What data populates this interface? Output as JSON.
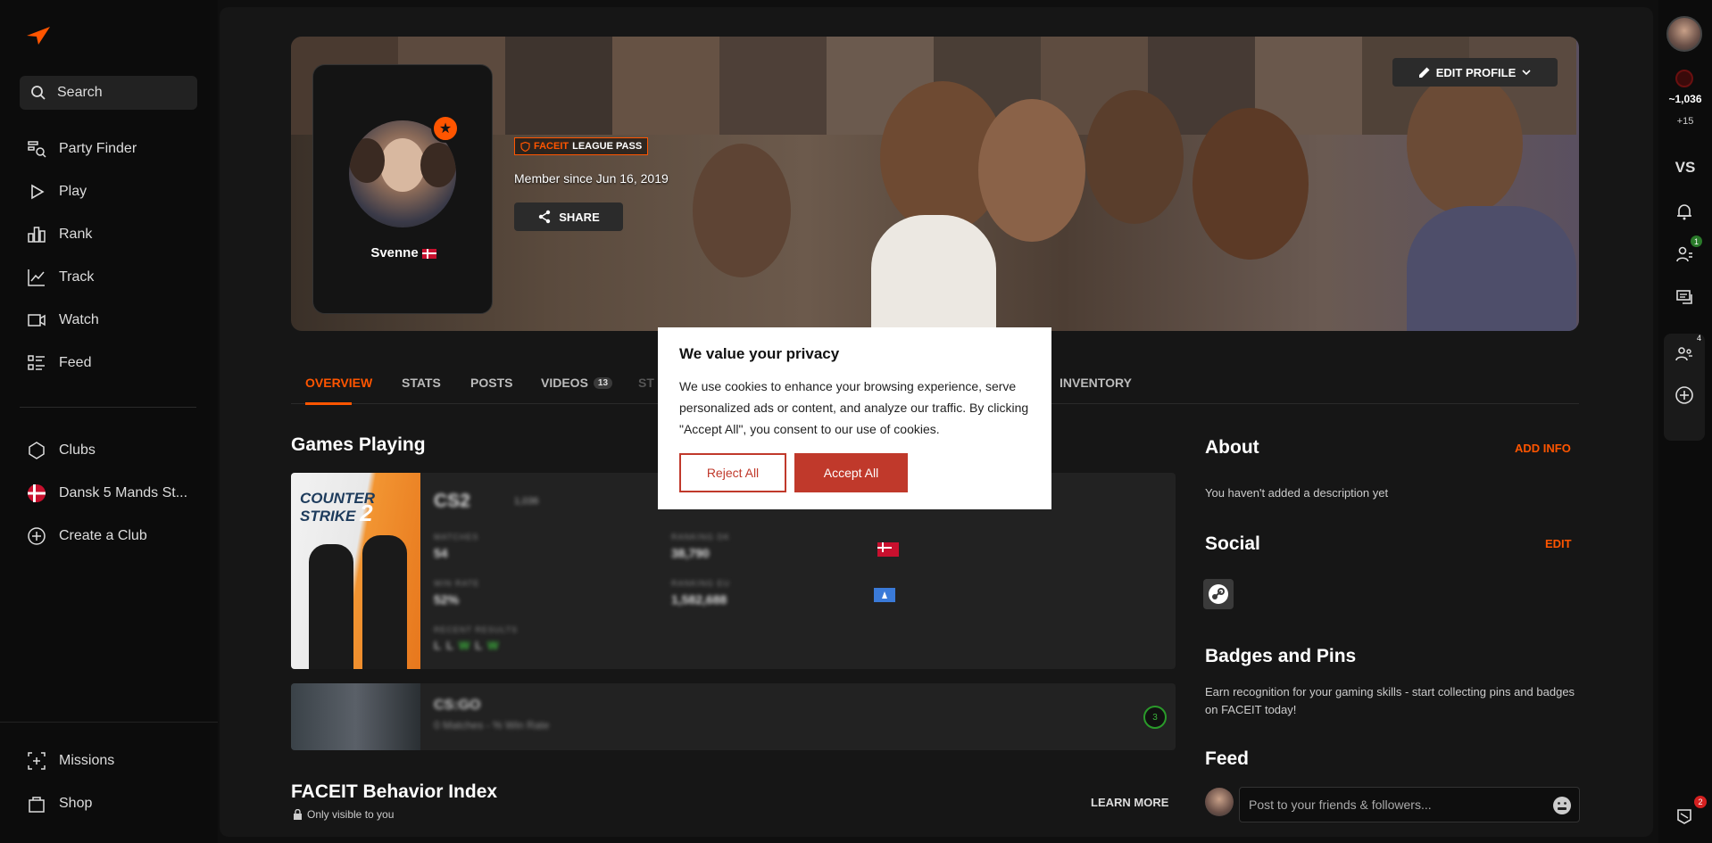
{
  "sidebar": {
    "search_label": "Search",
    "nav": [
      {
        "label": "Party Finder",
        "icon": "party-finder-icon"
      },
      {
        "label": "Play",
        "icon": "play-icon"
      },
      {
        "label": "Rank",
        "icon": "rank-icon"
      },
      {
        "label": "Track",
        "icon": "track-icon"
      },
      {
        "label": "Watch",
        "icon": "watch-icon"
      },
      {
        "label": "Feed",
        "icon": "feed-icon"
      }
    ],
    "clubs": [
      {
        "label": "Clubs",
        "icon": "clubs-icon"
      },
      {
        "label": "Dansk 5 Mands St...",
        "icon": "club-flag-icon"
      },
      {
        "label": "Create a Club",
        "icon": "plus-circle-icon"
      }
    ],
    "bottom": [
      {
        "label": "Missions",
        "icon": "missions-icon"
      },
      {
        "label": "Shop",
        "icon": "shop-icon"
      }
    ]
  },
  "profile": {
    "username": "Svenne",
    "league_pass_brand": "FACEIT",
    "league_pass_text": "LEAGUE PASS",
    "member_since": "Member since Jun 16, 2019",
    "share_label": "SHARE",
    "edit_profile_label": "EDIT PROFILE"
  },
  "tabs": [
    {
      "label": "OVERVIEW",
      "active": true
    },
    {
      "label": "STATS"
    },
    {
      "label": "POSTS"
    },
    {
      "label": "VIDEOS",
      "count": "13"
    },
    {
      "label": "ST"
    },
    {
      "label": "INVENTORY"
    }
  ],
  "games": {
    "title": "Games Playing",
    "cs2": {
      "art_text_1": "COUNTER",
      "art_text_2": "STRIKE",
      "art_num": "2",
      "name": "CS2",
      "elo": "1,036",
      "matches_label": "MATCHES",
      "matches_value": "54",
      "ranking_dk_label": "RANKING DK",
      "ranking_dk_value": "38,790",
      "win_rate_label": "WIN RATE",
      "win_rate_value": "52%",
      "ranking_eu_label": "RANKING EU",
      "ranking_eu_value": "1,582,688",
      "recent_label": "RECENT RESULTS",
      "recent": [
        "L",
        "L",
        "W",
        "L",
        "W"
      ]
    },
    "csgo": {
      "name": "CS:GO",
      "subtitle": "0 Matches - % Win Rate",
      "level": "3"
    }
  },
  "behavior": {
    "title": "FACEIT Behavior Index",
    "visibility": "Only visible to you",
    "learn_more": "LEARN MORE"
  },
  "about": {
    "title": "About",
    "add_info": "ADD INFO",
    "description": "You haven't added a description yet"
  },
  "social": {
    "title": "Social",
    "edit": "EDIT"
  },
  "badges": {
    "title": "Badges and Pins",
    "text": "Earn recognition for your gaming skills - start collecting pins and badges on FACEIT today!"
  },
  "feed": {
    "title": "Feed",
    "placeholder": "Post to your friends & followers..."
  },
  "rail": {
    "elo": "~1,036",
    "elo_delta": "+15",
    "vs_label": "VS",
    "friends_badge": "1",
    "party_badge": "4",
    "chat_badge": "2"
  },
  "cookie": {
    "title": "We value your privacy",
    "body": "We use cookies to enhance your browsing experience, serve personalized ads or content, and analyze our traffic. By clicking \"Accept All\", you consent to our use of cookies.",
    "reject": "Reject All",
    "accept": "Accept All"
  },
  "colors": {
    "accent": "#ff5500",
    "background": "#0f0f0f",
    "panel": "#161616",
    "cookie_button": "#c0392b"
  }
}
